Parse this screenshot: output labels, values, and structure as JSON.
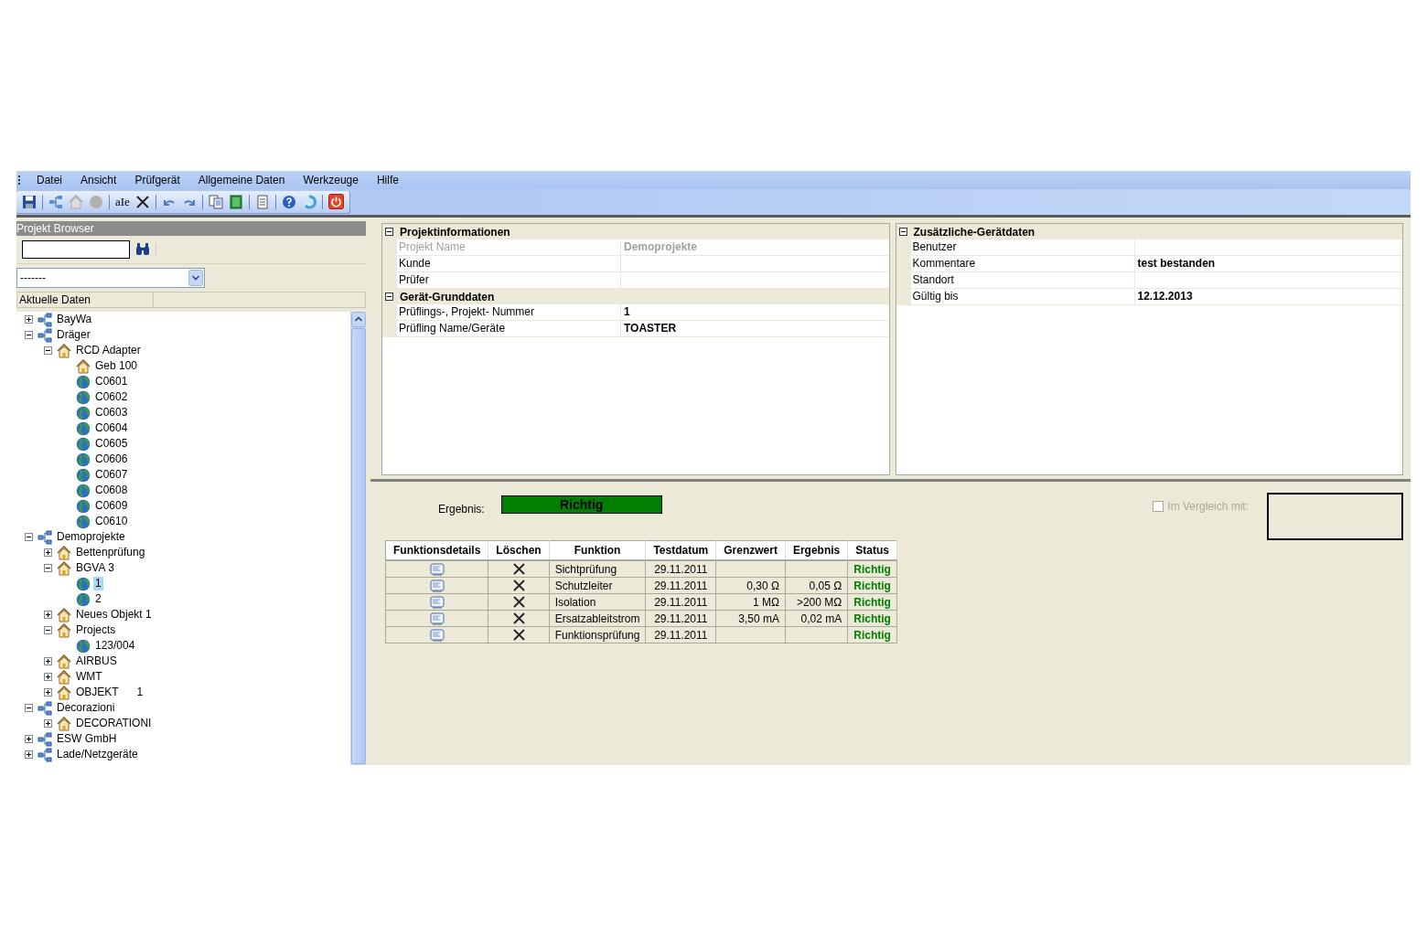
{
  "menu": [
    {
      "label": "Datei"
    },
    {
      "label": "Ansicht"
    },
    {
      "label": "Prüfgerät"
    },
    {
      "label": "Allgemeine Daten"
    },
    {
      "label": "Werkzeuge"
    },
    {
      "label": "Hilfe"
    }
  ],
  "toolbar": {
    "rename_label": "aIe"
  },
  "browser": {
    "title": "Projekt Browser",
    "dropdown_value": "-------",
    "column_header": "Aktuelle Daten",
    "tree": [
      {
        "label": "BayWa",
        "kind": "group",
        "expanded": false,
        "selected": false
      },
      {
        "label": "Dräger",
        "kind": "group",
        "expanded": true,
        "selected": false,
        "children": [
          {
            "label": "RCD Adapter",
            "kind": "house",
            "expanded": true,
            "selected": false,
            "children": [
              {
                "label": "Geb 100",
                "kind": "house",
                "selected": false
              },
              {
                "label": "C0601",
                "kind": "globe",
                "selected": false
              },
              {
                "label": "C0602",
                "kind": "globe",
                "selected": false
              },
              {
                "label": "C0603",
                "kind": "globe",
                "selected": false
              },
              {
                "label": "C0604",
                "kind": "globe",
                "selected": false
              },
              {
                "label": "C0605",
                "kind": "globe",
                "selected": false
              },
              {
                "label": "C0606",
                "kind": "globe",
                "selected": false
              },
              {
                "label": "C0607",
                "kind": "globe",
                "selected": false
              },
              {
                "label": "C0608",
                "kind": "globe",
                "selected": false
              },
              {
                "label": "C0609",
                "kind": "globe",
                "selected": false
              },
              {
                "label": "C0610",
                "kind": "globe",
                "selected": false
              }
            ]
          }
        ]
      },
      {
        "label": "Demoprojekte",
        "kind": "group",
        "expanded": true,
        "selected": false,
        "children": [
          {
            "label": "Bettenprüfung",
            "kind": "house",
            "expanded": false,
            "selected": false
          },
          {
            "label": "BGVA 3",
            "kind": "house",
            "expanded": true,
            "selected": false,
            "children": [
              {
                "label": "1",
                "kind": "globe",
                "selected": true
              },
              {
                "label": "2",
                "kind": "globe",
                "selected": false
              }
            ]
          },
          {
            "label": "Neues Objekt 1",
            "kind": "house",
            "expanded": false,
            "selected": false
          },
          {
            "label": "Projects",
            "kind": "house",
            "expanded": true,
            "selected": false,
            "children": [
              {
                "label": "123/004",
                "kind": "globe",
                "selected": false
              }
            ]
          },
          {
            "label": "AIRBUS",
            "kind": "house",
            "expanded": false,
            "selected": false
          },
          {
            "label": "WMT",
            "kind": "house",
            "expanded": false,
            "selected": false
          },
          {
            "label": "OBJEKT      1",
            "kind": "house",
            "expanded": false,
            "selected": false
          }
        ]
      },
      {
        "label": "Decorazioni",
        "kind": "group",
        "expanded": true,
        "selected": false,
        "children": [
          {
            "label": "DECORATIONI",
            "kind": "house",
            "expanded": false,
            "selected": false
          }
        ]
      },
      {
        "label": "ESW GmbH",
        "kind": "group",
        "expanded": false,
        "selected": false
      },
      {
        "label": "Lade/Netzgeräte",
        "kind": "group",
        "expanded": false,
        "selected": false
      }
    ]
  },
  "property_panels": [
    {
      "sections": [
        {
          "title": "Projektinformationen",
          "expanded": true,
          "rows": [
            {
              "label": "Projekt Name",
              "value": "Demoprojekte",
              "disabled": true
            },
            {
              "label": "Kunde",
              "disabled": false
            },
            {
              "label": "Prüfer",
              "disabled": false
            }
          ]
        },
        {
          "title": "Gerät-Grunddaten",
          "expanded": true,
          "rows": [
            {
              "label": "Prüflings-, Projekt- Nummer",
              "value": "1",
              "disabled": false
            },
            {
              "label": "Prüfling Name/Geräte",
              "value": "TOASTER",
              "disabled": false
            }
          ]
        }
      ]
    },
    {
      "sections": [
        {
          "title": "Zusätzliche-Gerätdaten",
          "expanded": true,
          "rows": [
            {
              "label": "Benutzer",
              "disabled": false
            },
            {
              "label": "Kommentare",
              "value": "test bestanden",
              "disabled": false
            },
            {
              "label": "Standort",
              "disabled": false
            },
            {
              "label": "Gültig bis",
              "value": "12.12.2013",
              "disabled": false
            }
          ]
        }
      ]
    }
  ],
  "result": {
    "label": "Ergebnis:",
    "value": "Richtig",
    "color": "#007f00"
  },
  "compare": {
    "label": "Im Vergleich mit:",
    "checked": false,
    "disabled": true
  },
  "table": {
    "columns": [
      "Funktionsdetails",
      "Löschen",
      "Funktion",
      "Testdatum",
      "Grenzwert",
      "Ergebnis",
      "Status"
    ],
    "rows": [
      {
        "function": "Sichtprüfung",
        "date": "29.11.2011",
        "status": "Richtig",
        "color": "#008000"
      },
      {
        "function": "Schutzleiter",
        "date": "29.11.2011",
        "limit": "0,30 Ω",
        "result": "0,05 Ω",
        "status": "Richtig",
        "color": "#008000"
      },
      {
        "function": "Isolation",
        "date": "29.11.2011",
        "limit": "1 MΩ",
        "result": ">200 MΩ",
        "status": "Richtig",
        "color": "#008000"
      },
      {
        "function": "Ersatzableitstrom",
        "date": "29.11.2011",
        "limit": "3,50 mA",
        "result": "0,02 mA",
        "status": "Richtig",
        "color": "#008000"
      },
      {
        "function": "Funktionsprüfung",
        "date": "29.11.2011",
        "status": "Richtig",
        "color": "#008000"
      }
    ]
  }
}
